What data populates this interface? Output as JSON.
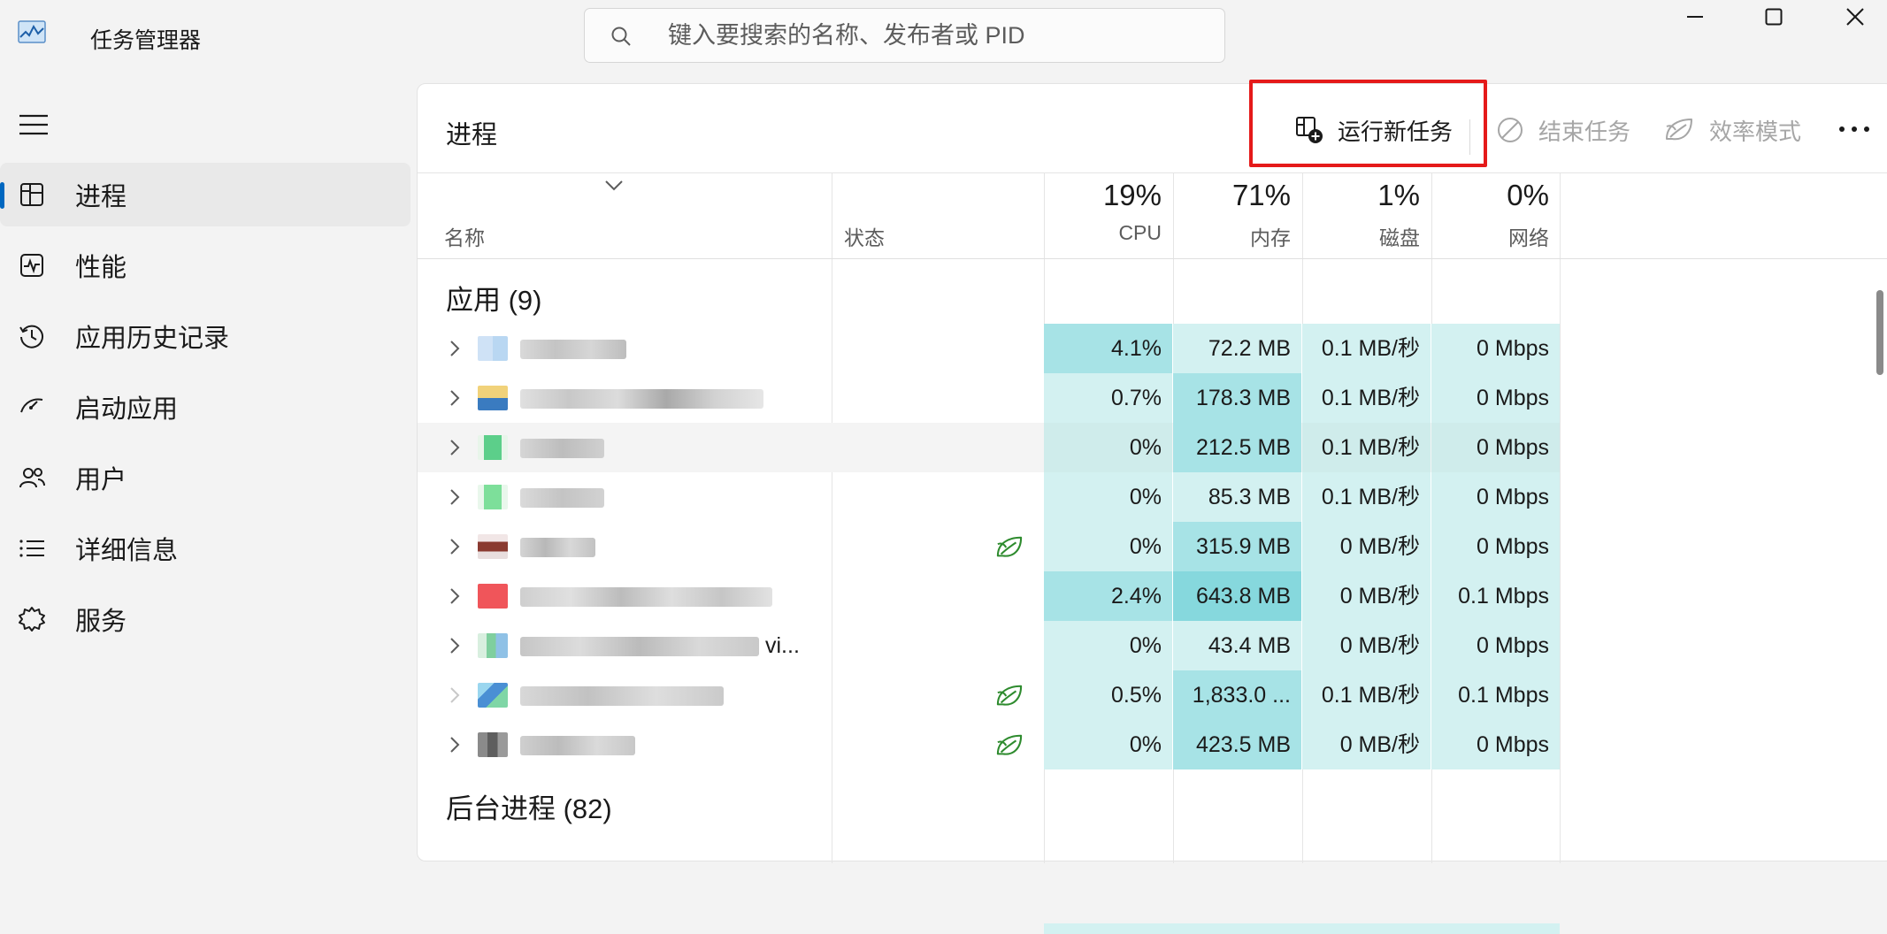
{
  "window": {
    "title": "任务管理器",
    "search_placeholder": "键入要搜索的名称、发布者或 PID"
  },
  "sidebar": {
    "items": [
      {
        "label": "进程",
        "icon": "processes-icon",
        "active": true
      },
      {
        "label": "性能",
        "icon": "performance-icon",
        "active": false
      },
      {
        "label": "应用历史记录",
        "icon": "history-icon",
        "active": false
      },
      {
        "label": "启动应用",
        "icon": "startup-icon",
        "active": false
      },
      {
        "label": "用户",
        "icon": "users-icon",
        "active": false
      },
      {
        "label": "详细信息",
        "icon": "details-icon",
        "active": false
      },
      {
        "label": "服务",
        "icon": "services-icon",
        "active": false
      }
    ]
  },
  "header": {
    "title": "进程",
    "run_new_task": "运行新任务",
    "end_task": "结束任务",
    "efficiency_mode": "效率模式"
  },
  "table": {
    "columns": {
      "name": "名称",
      "status": "状态",
      "cpu_pct": "19%",
      "cpu": "CPU",
      "memory_pct": "71%",
      "memory": "内存",
      "disk_pct": "1%",
      "disk": "磁盘",
      "network_pct": "0%",
      "network": "网络"
    },
    "apps_group": "应用 (9)",
    "background_group": "后台进程 (82)",
    "rows": [
      {
        "name_visible": "",
        "eco": false,
        "cpu": "4.1%",
        "mem": "72.2 MB",
        "disk": "0.1 MB/秒",
        "net": "0 Mbps"
      },
      {
        "name_visible": "",
        "eco": false,
        "cpu": "0.7%",
        "mem": "178.3 MB",
        "disk": "0.1 MB/秒",
        "net": "0 Mbps"
      },
      {
        "name_visible": "",
        "eco": false,
        "cpu": "0%",
        "mem": "212.5 MB",
        "disk": "0.1 MB/秒",
        "net": "0 Mbps"
      },
      {
        "name_visible": "",
        "eco": false,
        "cpu": "0%",
        "mem": "85.3 MB",
        "disk": "0.1 MB/秒",
        "net": "0 Mbps"
      },
      {
        "name_visible": "",
        "eco": true,
        "cpu": "0%",
        "mem": "315.9 MB",
        "disk": "0 MB/秒",
        "net": "0 Mbps"
      },
      {
        "name_visible": "",
        "eco": false,
        "cpu": "2.4%",
        "mem": "643.8 MB",
        "disk": "0 MB/秒",
        "net": "0.1 Mbps"
      },
      {
        "name_visible": "vi...",
        "eco": false,
        "cpu": "0%",
        "mem": "43.4 MB",
        "disk": "0 MB/秒",
        "net": "0 Mbps"
      },
      {
        "name_visible": "",
        "eco": true,
        "cpu": "0.5%",
        "mem": "1,833.0 ...",
        "disk": "0.1 MB/秒",
        "net": "0.1 Mbps"
      },
      {
        "name_visible": "",
        "eco": true,
        "cpu": "0%",
        "mem": "423.5 MB",
        "disk": "0 MB/秒",
        "net": "0 Mbps"
      }
    ]
  },
  "colors": {
    "accent": "#0067c0",
    "highlight_box": "#e51a1a",
    "heat_light": "#d3f1f1",
    "heat_mid": "#a7e3e6",
    "heat_strong": "#86d8dd",
    "eco_leaf": "#2e8b2e"
  }
}
